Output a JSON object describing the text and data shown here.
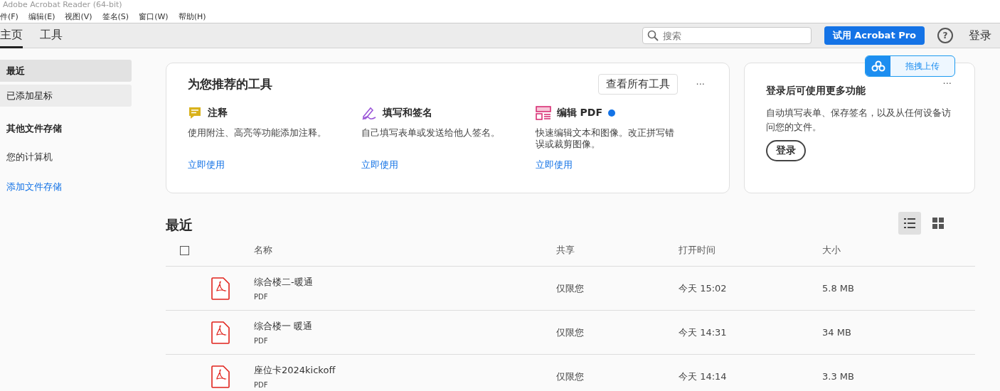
{
  "window": {
    "title": "Adobe Acrobat Reader (64-bit)"
  },
  "menu": [
    "件(F)",
    "编辑(E)",
    "视图(V)",
    "签名(S)",
    "窗口(W)",
    "帮助(H)"
  ],
  "tabs": [
    {
      "label": "主页",
      "selected": true
    },
    {
      "label": "工具",
      "selected": false
    }
  ],
  "search": {
    "placeholder": "搜索"
  },
  "try_button": "试用 Acrobat Pro",
  "help_icon": "?",
  "login_link": "登录",
  "upload_button": "拖拽上传",
  "sidebar": {
    "items": [
      {
        "label": "最近",
        "selected": true
      },
      {
        "label": "已添加星标",
        "selected": false
      }
    ],
    "section_title": "其他文件存储",
    "storage": [
      {
        "label": "您的计算机",
        "kind": "item"
      },
      {
        "label": "添加文件存储",
        "kind": "link"
      }
    ]
  },
  "tools_card": {
    "title": "为您推荐的工具",
    "view_all": "查看所有工具",
    "more": "···",
    "tools": [
      {
        "kind": "comment",
        "name": "注释",
        "description": "使用附注、高亮等功能添加注释。",
        "action": "立即使用"
      },
      {
        "kind": "sign",
        "name": "填写和签名",
        "description": "自己填写表单或发送给他人签名。",
        "action": "立即使用"
      },
      {
        "kind": "edit",
        "name": "编辑 PDF",
        "premium": true,
        "description": "快速编辑文本和图像。改正拼写错误或裁剪图像。",
        "action": "立即使用"
      }
    ]
  },
  "login_card": {
    "more": "···",
    "title": "登录后可使用更多功能",
    "text": "自动填写表单、保存签名，以及从任何设备访问您的文件。",
    "button": "登录"
  },
  "recent": {
    "title": "最近",
    "views": [
      {
        "kind": "list",
        "selected": true
      },
      {
        "kind": "grid",
        "selected": false
      }
    ],
    "select_all": {
      "checked": false
    },
    "columns": [
      "名称",
      "共享",
      "打开时间",
      "大小"
    ],
    "rows": [
      {
        "name": "综合楼二-暖通",
        "type": "PDF",
        "shared": "仅限您",
        "opened": "今天 15:02",
        "size": "5.8 MB"
      },
      {
        "name": "综合楼一 暖通",
        "type": "PDF",
        "shared": "仅限您",
        "opened": "今天 14:31",
        "size": "34 MB"
      },
      {
        "name": "座位卡2024kickoff",
        "type": "PDF",
        "shared": "仅限您",
        "opened": "今天 14:14",
        "size": "3.3 MB"
      }
    ]
  }
}
